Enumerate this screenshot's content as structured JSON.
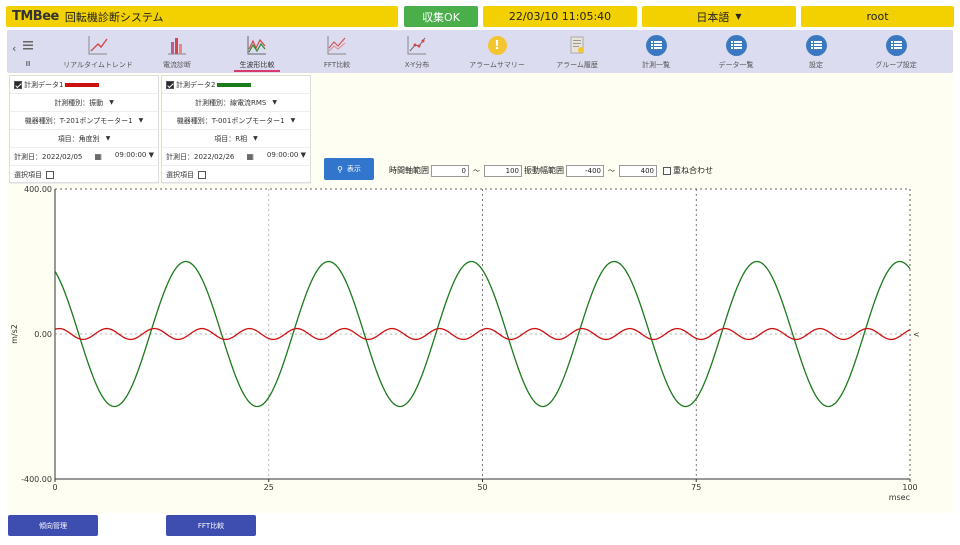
{
  "header": {
    "logo": "TMBee",
    "title": "回転機診断システム",
    "status": "収集OK",
    "datetime": "22/03/10 11:05:40",
    "language": "日本語",
    "user": "root"
  },
  "nav": {
    "back_glyph": "‹",
    "items": [
      {
        "label": "Ⅲ",
        "icon": "menu-icon"
      },
      {
        "label": "リアルタイムトレンド",
        "icon": "trend-chart-icon"
      },
      {
        "label": "電流診断",
        "icon": "current-icon"
      },
      {
        "label": "生波形比較",
        "icon": "waveform-compare-icon",
        "active": true
      },
      {
        "label": "FFT比較",
        "icon": "fft-icon"
      },
      {
        "label": "X-Y分布",
        "icon": "xy-scatter-icon"
      },
      {
        "label": "アラームサマリー",
        "icon": "alarm-summary-icon"
      },
      {
        "label": "アラーム履歴",
        "icon": "alarm-history-icon"
      },
      {
        "label": "計測一覧",
        "icon": "measure-list-icon"
      },
      {
        "label": "データ一覧",
        "icon": "data-list-icon"
      },
      {
        "label": "設定",
        "icon": "settings-icon"
      },
      {
        "label": "グループ設定",
        "icon": "group-settings-icon"
      }
    ]
  },
  "panels": [
    {
      "title": "計測データ1",
      "color": "#cc1111",
      "type_label": "計測種別：振動",
      "equipment_label": "機器種別：T-201ポンプモーター1",
      "item_label": "項目：角度別",
      "date_label": "計測日：",
      "date_value": "2022/02/05",
      "time_value": "09:00:00",
      "select_label": "選択項目"
    },
    {
      "title": "計測データ2",
      "color": "#1b7a1b",
      "type_label": "計測種別：線電流RMS",
      "equipment_label": "機器種別：T-001ポンプモーター1",
      "item_label": "項目：R相",
      "date_label": "計測日：",
      "date_value": "2022/02/26",
      "time_value": "09:00:00",
      "select_label": "選択項目"
    }
  ],
  "controls": {
    "show_button": "表示",
    "time_range_label": "時間軸範囲",
    "time_min": "0",
    "time_max": "100",
    "amp_range_label": "振動幅範囲",
    "amp_min": "-400",
    "amp_max": "400",
    "tilde": "～",
    "align_label": "重ね合わせ"
  },
  "chart_data": {
    "type": "line",
    "xlabel": "msec",
    "ylabel": "m/s2",
    "xlim": [
      0,
      100
    ],
    "ylim": [
      -400,
      400
    ],
    "xticks": [
      "0",
      "25",
      "50",
      "75",
      "100"
    ],
    "yticks": [
      "400.00",
      "0.00",
      "-400.00"
    ],
    "series": [
      {
        "name": "",
        "color": "#1b7a1b",
        "amplitude": 200,
        "period_ms": 16.7,
        "x_at_peak": 15.3,
        "y_at_x0": 150
      },
      {
        "name": "",
        "color": "#cc1111",
        "amplitude": 15,
        "period_ms": 5.56,
        "x_at_peak": 0.5,
        "y_at_x0": 12
      }
    ]
  },
  "footer": {
    "tendency_button": "傾向管理",
    "fft_button": "FFT比較"
  }
}
